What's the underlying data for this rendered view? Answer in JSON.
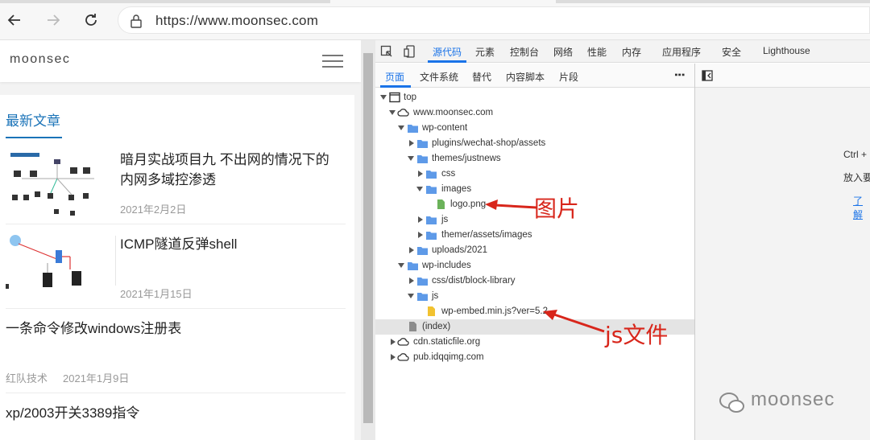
{
  "browser": {
    "url": "https://www.moonsec.com"
  },
  "site": {
    "logo": "moonsec",
    "section_title": "最新文章",
    "articles": [
      {
        "title": "暗月实战项目九 不出网的情况下的内网多域控渗透",
        "date": "2021年2月2日"
      },
      {
        "title": "ICMP隧道反弹shell",
        "date": "2021年1月15日"
      },
      {
        "title": "一条命令修改windows注册表",
        "category": "红队技术",
        "date": "2021年1月9日"
      },
      {
        "title": "xp/2003开关3389指令"
      }
    ]
  },
  "devtools": {
    "tabs": [
      "源代码",
      "元素",
      "控制台",
      "网络",
      "性能",
      "内存",
      "应用程序",
      "安全",
      "Lighthouse"
    ],
    "active_tab": "源代码",
    "subtabs": [
      "页面",
      "文件系统",
      "替代",
      "内容脚本",
      "片段"
    ],
    "more_label": "⋮",
    "tree": [
      {
        "label": "top",
        "type": "frame",
        "expanded": true
      },
      {
        "label": "www.moonsec.com",
        "type": "cloud",
        "expanded": true
      },
      {
        "label": "wp-content",
        "type": "folder",
        "expanded": true
      },
      {
        "label": "plugins/wechat-shop/assets",
        "type": "folder",
        "expanded": false
      },
      {
        "label": "themes/justnews",
        "type": "folder",
        "expanded": true
      },
      {
        "label": "css",
        "type": "folder",
        "expanded": false
      },
      {
        "label": "images",
        "type": "folder",
        "expanded": true
      },
      {
        "label": "logo.png",
        "type": "image-file"
      },
      {
        "label": "js",
        "type": "folder",
        "expanded": false
      },
      {
        "label": "themer/assets/images",
        "type": "folder",
        "expanded": false
      },
      {
        "label": "uploads/2021",
        "type": "folder",
        "expanded": false
      },
      {
        "label": "wp-includes",
        "type": "folder",
        "expanded": true
      },
      {
        "label": "css/dist/block-library",
        "type": "folder",
        "expanded": false
      },
      {
        "label": "js",
        "type": "folder",
        "expanded": true
      },
      {
        "label": "wp-embed.min.js?ver=5.2.",
        "type": "js-file"
      },
      {
        "label": "(index)",
        "type": "doc-file",
        "selected": true
      },
      {
        "label": "cdn.staticfile.org",
        "type": "cloud",
        "expanded": false
      },
      {
        "label": "pub.idqqimg.com",
        "type": "cloud",
        "expanded": false
      }
    ],
    "right_pane": {
      "line1": "Ctrl +",
      "line2": "放入要",
      "link": "了解"
    }
  },
  "annotations": {
    "image_label": "图片",
    "js_label": "js文件"
  },
  "watermark": "moonsec",
  "colors": {
    "accent_blue": "#1a73e8",
    "site_blue": "#1a73b8",
    "folder_blue": "#5e9ae8",
    "arrow_red": "#d8261b"
  }
}
